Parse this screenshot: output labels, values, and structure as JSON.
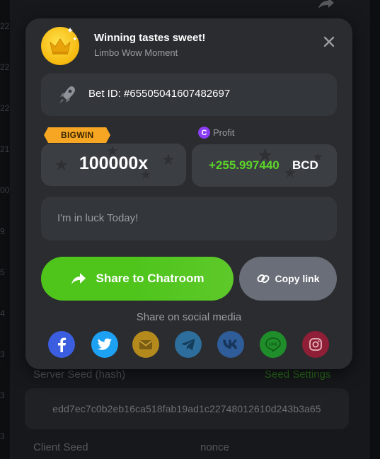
{
  "background": {
    "left_digits": [
      "22",
      "22",
      "22",
      "21",
      "00",
      "9",
      "5",
      "4",
      "3",
      "3",
      "3"
    ],
    "server_seed_label": "Server Seed (hash)",
    "seed_settings_label": "Seed Settings",
    "server_seed_hash": "edd7ec7c0b2eb16ca518fab19ad1c22748012610d243b3a65",
    "client_seed_label": "Client Seed",
    "nonce_label": "nonce"
  },
  "modal": {
    "title": "Winning tastes sweet!",
    "subtitle": "Limbo Wow Moment",
    "bet_id": "Bet ID: #65505041607482697",
    "badge": "BIGWIN",
    "profit_label": "Profit",
    "profit_coin_symbol": "C",
    "multiplier": "100000x",
    "profit_value": "+255.997440",
    "currency": "BCD",
    "message_placeholder": "I'm in luck Today!",
    "share_label": "Share to Chatroom",
    "copy_label": "Copy link",
    "social_label": "Share on social media",
    "social": [
      {
        "name": "facebook-icon",
        "color": "#3b5ee0"
      },
      {
        "name": "twitter-icon",
        "color": "#1da1f2"
      },
      {
        "name": "email-icon",
        "color": "#b48a1d"
      },
      {
        "name": "telegram-icon",
        "color": "#2d6e9c"
      },
      {
        "name": "vk-icon",
        "color": "#2f5d9a"
      },
      {
        "name": "line-icon",
        "color": "#1f8d29"
      },
      {
        "name": "instagram-icon",
        "color": "#8f1f36"
      }
    ]
  },
  "colors": {
    "accent_green": "#4fc51c",
    "profit_green": "#5cd52a",
    "badge_orange": "#f6a623",
    "modal_bg": "#2a2c30"
  }
}
